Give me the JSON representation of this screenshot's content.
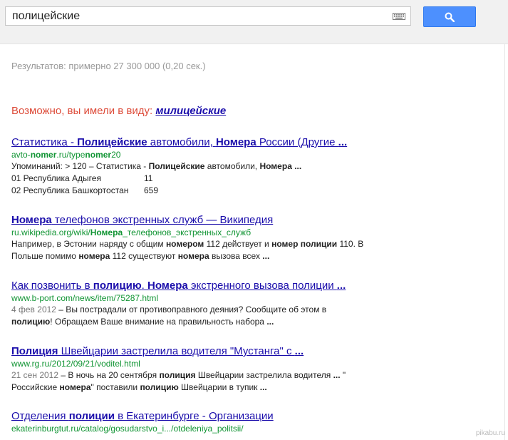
{
  "search": {
    "query": "полицейские"
  },
  "stats": "Результатов: примерно 27 300 000 (0,20 сек.)",
  "suggestion": {
    "prefix": "Возможно, вы имели в виду: ",
    "term": "милицейские"
  },
  "results": [
    {
      "title_parts": [
        {
          "t": "Статистика - ",
          "b": false
        },
        {
          "t": "Полицейские",
          "b": true
        },
        {
          "t": " автомобили, ",
          "b": false
        },
        {
          "t": "Номера",
          "b": true
        },
        {
          "t": " России (Другие ",
          "b": false
        },
        {
          "t": "...",
          "b": true
        }
      ],
      "url_parts": [
        {
          "t": "avto-",
          "b": false
        },
        {
          "t": "nomer",
          "b": true
        },
        {
          "t": ".ru/type",
          "b": false
        },
        {
          "t": "nomer",
          "b": true
        },
        {
          "t": "20",
          "b": false
        }
      ],
      "snippet_parts": [
        {
          "t": "Упоминаний: > 120 – Статистика - ",
          "b": false
        },
        {
          "t": "Полицейские",
          "b": true
        },
        {
          "t": " автомобили, ",
          "b": false
        },
        {
          "t": "Номера",
          "b": true
        },
        {
          "t": " ...",
          "b": true
        }
      ],
      "table": [
        {
          "k": "01 Республика Адыгея",
          "v": "11"
        },
        {
          "k": "02 Республика Башкортостан",
          "v": "659"
        }
      ]
    },
    {
      "title_parts": [
        {
          "t": "Номера",
          "b": true
        },
        {
          "t": " телефонов экстренных служб — Википедия",
          "b": false
        }
      ],
      "url_parts": [
        {
          "t": "ru.wikipedia.org/wiki/",
          "b": false
        },
        {
          "t": "Номера",
          "b": true
        },
        {
          "t": "_телефонов_экстренных_служб",
          "b": false
        }
      ],
      "snippet_parts": [
        {
          "t": "Например, в Эстонии наряду с общим ",
          "b": false
        },
        {
          "t": "номером",
          "b": true
        },
        {
          "t": " 112 действует и ",
          "b": false
        },
        {
          "t": "номер полиции",
          "b": true
        },
        {
          "t": " 110. В Польше помимо ",
          "b": false
        },
        {
          "t": "номера",
          "b": true
        },
        {
          "t": " 112 существуют ",
          "b": false
        },
        {
          "t": "номера",
          "b": true
        },
        {
          "t": " вызова всех ",
          "b": false
        },
        {
          "t": "...",
          "b": true
        }
      ]
    },
    {
      "title_parts": [
        {
          "t": "Как позвонить в ",
          "b": false
        },
        {
          "t": "полицию",
          "b": true
        },
        {
          "t": ". ",
          "b": false
        },
        {
          "t": "Номера",
          "b": true
        },
        {
          "t": " экстренного вызова полиции ",
          "b": false
        },
        {
          "t": "...",
          "b": true
        }
      ],
      "url_parts": [
        {
          "t": "www.b-port.com/news/item/75287.html",
          "b": false
        }
      ],
      "date": "4 фев 2012",
      "snippet_parts": [
        {
          "t": " – Вы пострадали от противоправного деяния? Сообщите об этом в ",
          "b": false
        },
        {
          "t": "полицию",
          "b": true
        },
        {
          "t": "! Обращаем Ваше внимание на правильность набора ",
          "b": false
        },
        {
          "t": "...",
          "b": true
        }
      ]
    },
    {
      "title_parts": [
        {
          "t": "Полиция",
          "b": true
        },
        {
          "t": " Швейцарии застрелила водителя \"Мустанга\" с ",
          "b": false
        },
        {
          "t": "...",
          "b": true
        }
      ],
      "url_parts": [
        {
          "t": "www.rg.ru/2012/09/21/voditel.html",
          "b": false
        }
      ],
      "date": "21 сен 2012",
      "snippet_parts": [
        {
          "t": " – В ночь на 20 сентября ",
          "b": false
        },
        {
          "t": "полиция",
          "b": true
        },
        {
          "t": " Швейцарии застрелила водителя ",
          "b": false
        },
        {
          "t": "...",
          "b": true
        },
        {
          "t": " \" Российские ",
          "b": false
        },
        {
          "t": "номера",
          "b": true
        },
        {
          "t": "\" поставили ",
          "b": false
        },
        {
          "t": "полицию",
          "b": true
        },
        {
          "t": " Швейцарии в тупик ",
          "b": false
        },
        {
          "t": "...",
          "b": true
        }
      ]
    },
    {
      "title_parts": [
        {
          "t": "Отделения ",
          "b": false
        },
        {
          "t": "полиции",
          "b": true
        },
        {
          "t": " в Екатеринбурге - Организации",
          "b": false
        }
      ],
      "url_parts": [
        {
          "t": "ekaterinburgtut.ru/catalog/gosudarstvo_i.../otdeleniya_politsii/",
          "b": false
        }
      ]
    }
  ],
  "watermark": "pikabu.ru",
  "colors": {
    "link": "#1a0dab",
    "url": "#109433",
    "accent": "#4d90fe",
    "suggest": "#dd4b39"
  }
}
